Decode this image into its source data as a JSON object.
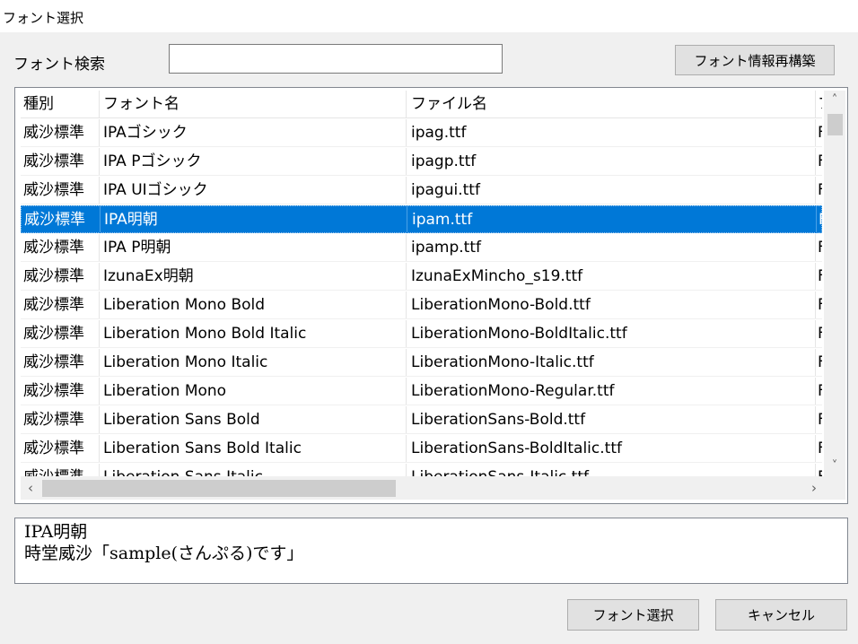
{
  "window": {
    "title": "フォント選択"
  },
  "search": {
    "label": "フォント検索",
    "value": ""
  },
  "buttons": {
    "rebuild": "フォント情報再構築",
    "select": "フォント選択",
    "cancel": "キャンセル"
  },
  "table": {
    "columns": [
      "種別",
      "フォント名",
      "ファイル名",
      "フ"
    ],
    "selected_index": 3,
    "rows": [
      {
        "type": "威沙標準",
        "name": "IPAゴシック",
        "file": "ipag.ttf",
        "extra": "F"
      },
      {
        "type": "威沙標準",
        "name": "IPA Pゴシック",
        "file": "ipagp.ttf",
        "extra": "F"
      },
      {
        "type": "威沙標準",
        "name": "IPA UIゴシック",
        "file": "ipagui.ttf",
        "extra": "F"
      },
      {
        "type": "威沙標準",
        "name": "IPA明朝",
        "file": "ipam.ttf",
        "extra": "F"
      },
      {
        "type": "威沙標準",
        "name": "IPA P明朝",
        "file": "ipamp.ttf",
        "extra": "F"
      },
      {
        "type": "威沙標準",
        "name": "IzunaEx明朝",
        "file": "IzunaExMincho_s19.ttf",
        "extra": "F"
      },
      {
        "type": "威沙標準",
        "name": "Liberation Mono Bold",
        "file": "LiberationMono-Bold.ttf",
        "extra": "F"
      },
      {
        "type": "威沙標準",
        "name": "Liberation Mono Bold Italic",
        "file": "LiberationMono-BoldItalic.ttf",
        "extra": "F"
      },
      {
        "type": "威沙標準",
        "name": "Liberation Mono Italic",
        "file": "LiberationMono-Italic.ttf",
        "extra": "F"
      },
      {
        "type": "威沙標準",
        "name": "Liberation Mono",
        "file": "LiberationMono-Regular.ttf",
        "extra": "F"
      },
      {
        "type": "威沙標準",
        "name": "Liberation Sans Bold",
        "file": "LiberationSans-Bold.ttf",
        "extra": "F"
      },
      {
        "type": "威沙標準",
        "name": "Liberation Sans Bold Italic",
        "file": "LiberationSans-BoldItalic.ttf",
        "extra": "F"
      },
      {
        "type": "威沙標準",
        "name": "Liberation Sans Italic",
        "file": "LiberationSans-Italic.ttf",
        "extra": "F"
      }
    ]
  },
  "preview": {
    "line1": "IPA明朝",
    "line2": "時堂威沙「sample(さんぷる)です」"
  },
  "colors": {
    "selection": "#0078d7",
    "background": "#f0f0f0"
  }
}
